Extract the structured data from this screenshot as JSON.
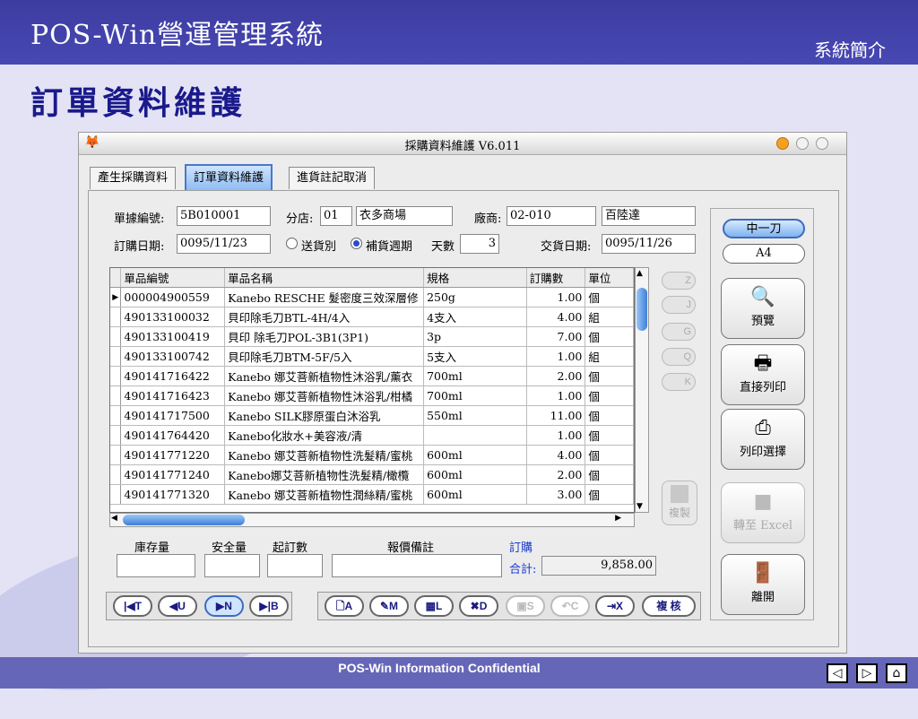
{
  "slide": {
    "title": "POS-Win營運管理系統",
    "intro_link": "系統簡介",
    "heading": "訂單資料維護",
    "footer": "POS-Win Information Confidential",
    "nav": {
      "prev": "◁",
      "next": "▷",
      "home": "⌂"
    }
  },
  "window": {
    "title": "採購資料維護 V6.011",
    "tabs": [
      "產生採購資料",
      "訂單資料維護",
      "進貨註記取消"
    ],
    "active_tab": 1
  },
  "form": {
    "doc_no_label": "單據編號:",
    "doc_no": "5B010001",
    "branch_label": "分店:",
    "branch_code": "01",
    "branch_name": "衣多商場",
    "vendor_label": "廠商:",
    "vendor_code": "02-010",
    "vendor_name": "百陸達",
    "order_date_label": "訂購日期:",
    "order_date": "0095/11/23",
    "radio_option_1": "送貨別",
    "radio_option_2": "補貨週期",
    "days_label": "天數",
    "days": "3",
    "delivery_date_label": "交貨日期:",
    "delivery_date": "0095/11/26"
  },
  "grid": {
    "columns": [
      "單品編號",
      "單品名稱",
      "規格",
      "訂購數",
      "單位"
    ],
    "rows": [
      {
        "code": "000004900559",
        "name": "Kanebo RESCHE 髮密度三效深層修",
        "spec": "250g",
        "qty": "1.00",
        "unit": "個"
      },
      {
        "code": "490133100032",
        "name": "貝印除毛刀BTL-4H/4入",
        "spec": "4支入",
        "qty": "4.00",
        "unit": "組"
      },
      {
        "code": "490133100419",
        "name": "貝印 除毛刀POL-3B1(3P1)",
        "spec": "3p",
        "qty": "7.00",
        "unit": "個"
      },
      {
        "code": "490133100742",
        "name": "貝印除毛刀BTM-5F/5入",
        "spec": "5支入",
        "qty": "1.00",
        "unit": "組"
      },
      {
        "code": "490141716422",
        "name": "Kanebo 娜艾菩新植物性沐浴乳/薰衣",
        "spec": "700ml",
        "qty": "2.00",
        "unit": "個"
      },
      {
        "code": "490141716423",
        "name": "Kanebo 娜艾菩新植物性沐浴乳/柑橘",
        "spec": "700ml",
        "qty": "1.00",
        "unit": "個"
      },
      {
        "code": "490141717500",
        "name": "Kanebo SILK膠原蛋白沐浴乳",
        "spec": "550ml",
        "qty": "11.00",
        "unit": "個"
      },
      {
        "code": "490141764420",
        "name": "Kanebo化妝水+美容液/清",
        "spec": "",
        "qty": "1.00",
        "unit": "個"
      },
      {
        "code": "490141771220",
        "name": "Kanebo 娜艾菩新植物性洗髮精/蜜桃",
        "spec": "600ml",
        "qty": "4.00",
        "unit": "個"
      },
      {
        "code": "490141771240",
        "name": "Kanebo娜艾菩新植物性洗髮精/橄欖",
        "spec": "600ml",
        "qty": "2.00",
        "unit": "個"
      },
      {
        "code": "490141771320",
        "name": "Kanebo 娜艾菩新植物性潤絲精/蜜桃",
        "spec": "600ml",
        "qty": "3.00",
        "unit": "個"
      }
    ]
  },
  "side_icons": [
    "Z",
    "J",
    "G",
    "Q",
    "K"
  ],
  "copy_label": "複製",
  "bottom": {
    "stock_label": "庫存量",
    "safety_label": "安全量",
    "min_order_label": "起訂數",
    "quote_note_label": "報價備註",
    "order_label": "訂購",
    "total_label": "合計:",
    "total_value": "9,858.00"
  },
  "nav_buttons": {
    "top": "T",
    "up": "U",
    "next": "N",
    "bottom": "B"
  },
  "action_buttons": {
    "add": "A",
    "modify": "M",
    "list": "L",
    "delete": "D",
    "save": "S",
    "cancel": "C",
    "exit": "X",
    "review": "複 核"
  },
  "right_panel": {
    "paper_option_1": "中一刀",
    "paper_option_2": "A4",
    "preview": "預覽",
    "direct_print": "直接列印",
    "print_select": "列印選擇",
    "to_excel": "轉至 Excel",
    "leave": "離開"
  }
}
